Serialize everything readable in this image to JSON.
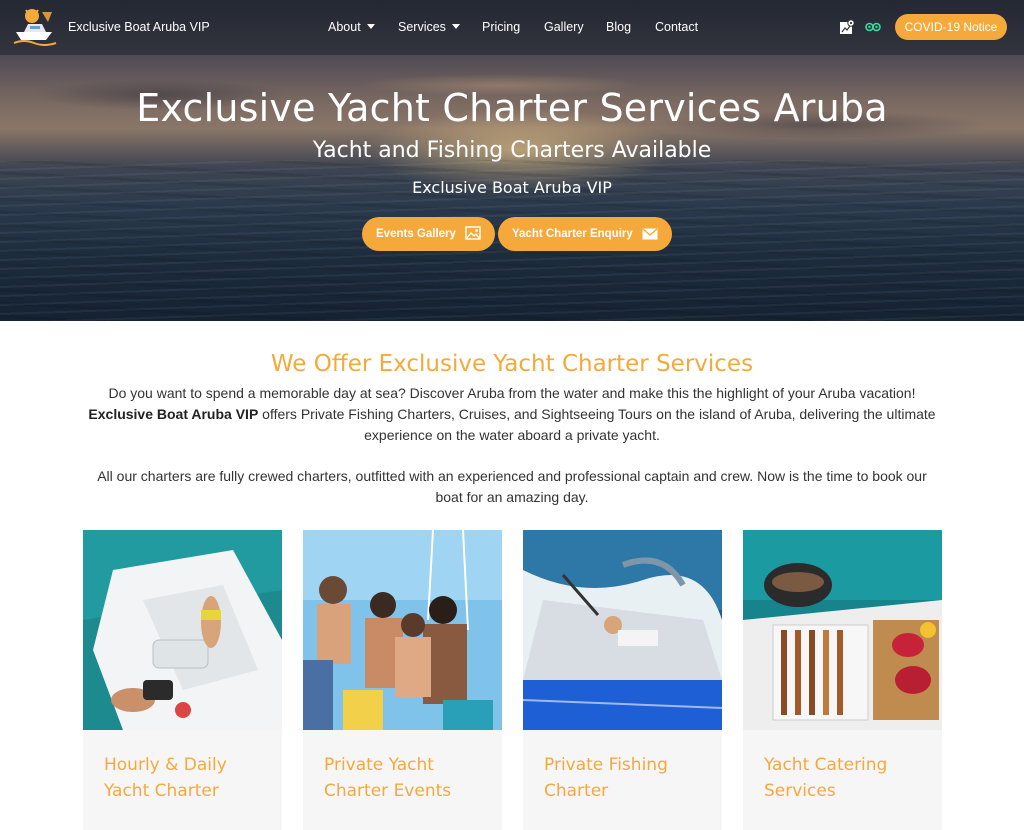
{
  "nav": {
    "brand": "Exclusive Boat Aruba VIP",
    "items": [
      {
        "label": "About",
        "dropdown": true
      },
      {
        "label": "Services",
        "dropdown": true
      },
      {
        "label": "Pricing",
        "dropdown": false
      },
      {
        "label": "Gallery",
        "dropdown": false
      },
      {
        "label": "Blog",
        "dropdown": false
      },
      {
        "label": "Contact",
        "dropdown": false
      }
    ],
    "icons": [
      "map-pin-icon",
      "tripadvisor-icon"
    ],
    "covid_button": "COVID-19 Notice"
  },
  "hero": {
    "title": "Exclusive Yacht Charter Services Aruba",
    "subtitle": "Yacht and Fishing Charters Available",
    "brand": "Exclusive Boat Aruba VIP",
    "buttons": [
      {
        "label": "Events Gallery",
        "icon": "gallery-icon"
      },
      {
        "label": "Yacht Charter Enquiry",
        "icon": "envelope-icon"
      }
    ]
  },
  "main": {
    "title": "We Offer Exclusive Yacht Charter Services",
    "para1_a": "Do you want to spend a memorable day at sea? Discover Aruba from the water and make this the highlight of your Aruba vacation! ",
    "para1_bold": "Exclusive Boat Aruba VIP",
    "para1_b": " offers Private Fishing Charters, Cruises, and Sightseeing Tours on the island of Aruba, delivering the ultimate experience on the water aboard a private yacht.",
    "para2": "All our charters are fully crewed charters, outfitted with an experienced and professional captain and crew. Now is the time to book our boat for an amazing day.",
    "cards": [
      {
        "title": "Hourly & Daily Yacht Charter"
      },
      {
        "title": "Private Yacht Charter Events"
      },
      {
        "title": "Private Fishing Charter"
      },
      {
        "title": "Yacht Catering Services"
      }
    ]
  },
  "colors": {
    "accent": "#f5a93a",
    "text": "#333333",
    "card_bg": "#f6f6f6"
  }
}
